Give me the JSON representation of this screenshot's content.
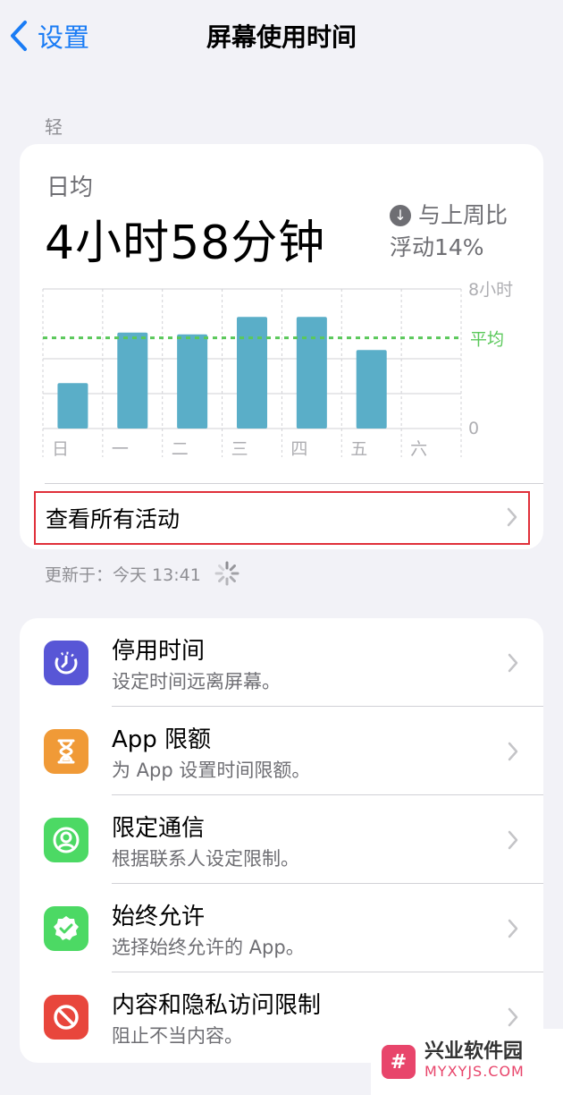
{
  "nav": {
    "back_label": "设置",
    "title": "屏幕使用时间"
  },
  "section_label": "轻",
  "summary": {
    "avg_label": "日均",
    "avg_value": "4小时58分钟",
    "compare_line1": "与上周比",
    "compare_line2": "浮动14%",
    "see_all": "查看所有活动"
  },
  "chart_data": {
    "type": "bar",
    "categories": [
      "日",
      "一",
      "二",
      "三",
      "四",
      "五",
      "六"
    ],
    "values": [
      2.6,
      5.5,
      5.4,
      6.4,
      6.4,
      4.5,
      0
    ],
    "average": 5.2,
    "average_label": "平均",
    "y_tick_labels": [
      "8小时",
      "0"
    ],
    "ylim": [
      0,
      8
    ],
    "bar_color": "#5aaec8",
    "average_color": "#5ac85a"
  },
  "updated": {
    "text": "更新于：今天 13:41"
  },
  "list": [
    {
      "title": "停用时间",
      "subtitle": "设定时间远离屏幕。",
      "icon": "downtime-icon",
      "color": "#5856d6"
    },
    {
      "title": "App 限额",
      "subtitle": "为 App 设置时间限额。",
      "icon": "hourglass-icon",
      "color": "#f09a37"
    },
    {
      "title": "限定通信",
      "subtitle": "根据联系人设定限制。",
      "icon": "contact-icon",
      "color": "#4cd964"
    },
    {
      "title": "始终允许",
      "subtitle": "选择始终允许的 App。",
      "icon": "check-badge-icon",
      "color": "#4cd964"
    },
    {
      "title": "内容和隐私访问限制",
      "subtitle": "阻止不当内容。",
      "icon": "block-icon",
      "color": "#e8463c"
    }
  ],
  "watermark": {
    "name": "兴业软件园",
    "domain": "MYXYJS.COM"
  }
}
